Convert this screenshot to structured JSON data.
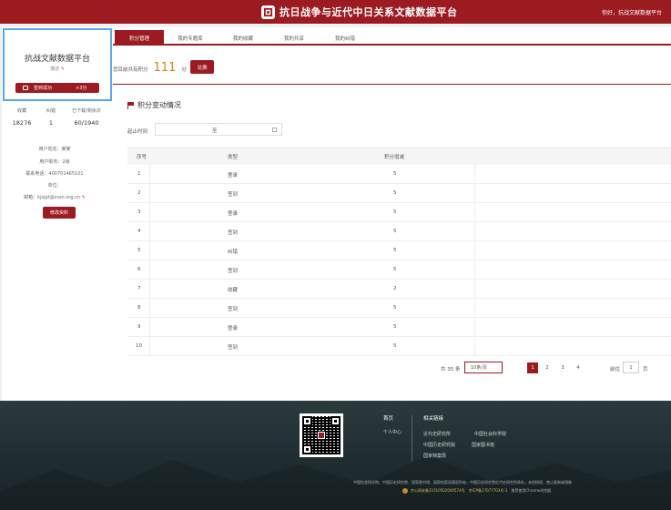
{
  "header": {
    "site_title": "抗日战争与近代中日关系文献数据平台",
    "greeting": "你好，抗战文献数据平台"
  },
  "sidebar": {
    "profile_name": "抗战文献数据平台",
    "profile_status": "描述",
    "signin_label": "签到成功",
    "signin_points": "+3分",
    "stats": [
      {
        "label": "收藏",
        "value": "18276"
      },
      {
        "label": "纠错",
        "value": "1"
      },
      {
        "label": "已下载/剩余次",
        "value": "60/1940"
      }
    ],
    "info": [
      "用户姓名：某某",
      "用户职务：2级",
      "联系电话：400701465101",
      "单位：",
      "邮箱：kjsjpt@cssn.org.cn"
    ],
    "edit_button": "修改资料"
  },
  "tabs": [
    {
      "label": "积分管理",
      "active": true
    },
    {
      "label": "我的专题库",
      "active": false
    },
    {
      "label": "我的收藏",
      "active": false
    },
    {
      "label": "我的共享",
      "active": false
    },
    {
      "label": "我的纠错",
      "active": false
    }
  ],
  "score": {
    "label": "您目前共有积分",
    "value": "111",
    "unit": "分",
    "redeem_label": "兑换"
  },
  "section_title": "积分变动情况",
  "filter": {
    "label": "起止时间",
    "value": "至"
  },
  "table": {
    "headers": [
      "序号",
      "类型",
      "积分增减"
    ],
    "rows": [
      {
        "no": "1",
        "type": "登录",
        "delta": "5"
      },
      {
        "no": "2",
        "type": "签到",
        "delta": "5"
      },
      {
        "no": "3",
        "type": "登录",
        "delta": "5"
      },
      {
        "no": "4",
        "type": "签到",
        "delta": "5"
      },
      {
        "no": "5",
        "type": "纠错",
        "delta": "5"
      },
      {
        "no": "6",
        "type": "签到",
        "delta": "5"
      },
      {
        "no": "7",
        "type": "收藏",
        "delta": "2"
      },
      {
        "no": "8",
        "type": "签到",
        "delta": "5"
      },
      {
        "no": "9",
        "type": "登录",
        "delta": "5"
      },
      {
        "no": "10",
        "type": "签到",
        "delta": "5"
      }
    ]
  },
  "pagination": {
    "total_label": "共 35 条",
    "page_size": "10条/页",
    "pages": [
      "1",
      "2",
      "3",
      "4"
    ],
    "current_page": "1",
    "goto_label": "前往",
    "goto_value": "1",
    "page_unit": "页"
  },
  "footer": {
    "home": "首页",
    "personal_center": "个人中心",
    "links_title": "相关链接",
    "links": [
      "近代史研究所",
      "中国社会科学院",
      "中国历史研究院",
      "国家图书馆",
      "国家档案局"
    ],
    "copyright": "中国社会科学院、中国历史研究院、国家图书馆、国家档案局版权所有，中国历史研究院近代史研究所承办，未经授权，禁止复制或镜像",
    "icp_1": "京公网安备11010502040574号",
    "icp_2": "京ICP备17077703号-1",
    "browser_note": "推荐使用Chrome浏览器"
  },
  "colors": {
    "brand_red": "#9b1b21",
    "score_gold": "#c28a1a",
    "footer_bg": "#2b3a3c",
    "focus_blue": "#5aa9e6"
  }
}
